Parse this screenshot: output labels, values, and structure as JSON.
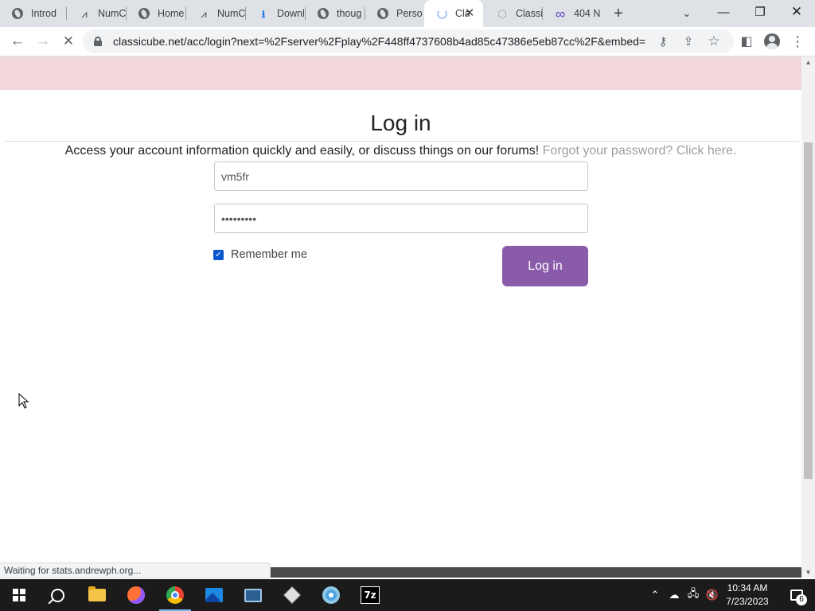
{
  "tabs": [
    {
      "label": "Introd",
      "icon": "globe-icon"
    },
    {
      "label": "NumC",
      "icon": "numc-icon"
    },
    {
      "label": "Home",
      "icon": "globe-icon"
    },
    {
      "label": "NumC",
      "icon": "numc-icon"
    },
    {
      "label": "Downl",
      "icon": "download-icon"
    },
    {
      "label": "thoug",
      "icon": "globe-icon"
    },
    {
      "label": "Persor",
      "icon": "globe-icon"
    },
    {
      "label": "Cla",
      "icon": "loading-spinner-icon",
      "active": true
    },
    {
      "label": "Classi",
      "icon": "cube-icon"
    },
    {
      "label": "404 N",
      "icon": "infinity-icon"
    }
  ],
  "address_bar": {
    "url": "classicube.net/acc/login?next=%2Fserver%2Fplay%2F448ff4737608b4ad85c47386e5eb87cc%2F&embed=..."
  },
  "page": {
    "title": "Log in",
    "intro_text": "Access your account information quickly and easily, or discuss things on our forums!",
    "forgot_link": "Forgot your password? Click here.",
    "username_value": "vm5fr",
    "password_value": "•••••••••",
    "remember_label": "Remember me",
    "remember_checked": true,
    "login_button": "Log in",
    "accent_color": "#8a5ba8",
    "banner_color": "#f2d7da"
  },
  "status_bar": {
    "text": "Waiting for stats.andrewph.org..."
  },
  "taskbar": {
    "apps": [
      "start-icon",
      "search-icon",
      "file-explorer-icon",
      "firefox-icon",
      "chrome-icon",
      "photos-icon",
      "remote-desktop-icon",
      "package-icon",
      "disc-burner-icon",
      "7zip-icon"
    ],
    "active_app": "chrome-icon",
    "sevenzip_label": "7z",
    "clock_time": "10:34 AM",
    "clock_date": "7/23/2023",
    "notification_count": "6"
  }
}
